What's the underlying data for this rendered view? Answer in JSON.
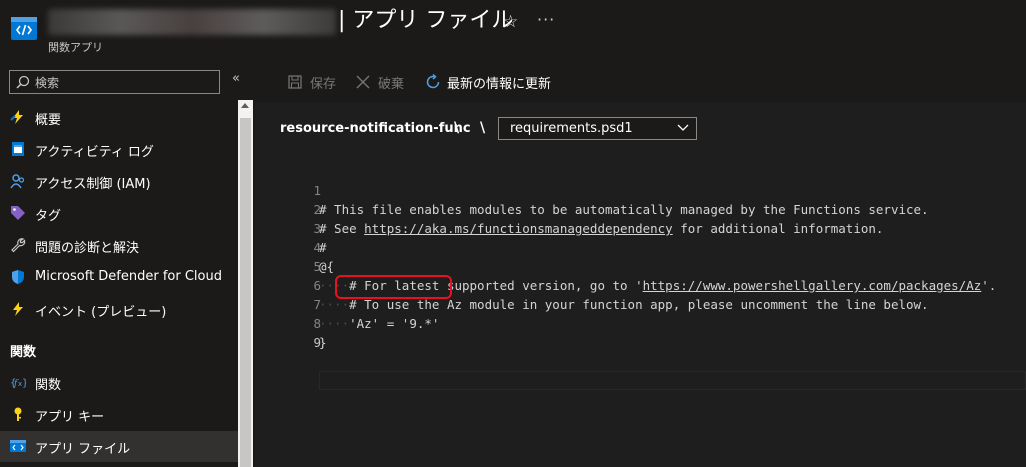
{
  "header": {
    "title": "| アプリ ファイル",
    "subtitle": "関数アプリ"
  },
  "sidebar": {
    "search_placeholder": "検索",
    "collapse_label": "«",
    "items": [
      {
        "label": "概要",
        "icon": "lightning-icon"
      },
      {
        "label": "アクティビティ ログ",
        "icon": "activity-log-icon"
      },
      {
        "label": "アクセス制御 (IAM)",
        "icon": "people-icon"
      },
      {
        "label": "タグ",
        "icon": "tag-icon"
      },
      {
        "label": "問題の診断と解決",
        "icon": "wrench-icon"
      },
      {
        "label": "Microsoft Defender for Cloud",
        "icon": "shield-icon"
      },
      {
        "label": "イベント (プレビュー)",
        "icon": "lightning-icon"
      }
    ],
    "section_functions": "関数",
    "function_items": [
      {
        "label": "関数",
        "icon": "function-icon"
      },
      {
        "label": "アプリ キー",
        "icon": "key-icon"
      },
      {
        "label": "アプリ ファイル",
        "icon": "code-icon",
        "active": true
      }
    ]
  },
  "toolbar": {
    "save_label": "保存",
    "discard_label": "破棄",
    "refresh_label": "最新の情報に更新"
  },
  "path": {
    "function_name": "resource-notification-func",
    "separator": "\\",
    "selected_file": "requirements.psd1"
  },
  "editor": {
    "lines": [
      {
        "n": "1",
        "text": "# This file enables modules to be automatically managed by the Functions service."
      },
      {
        "n": "2",
        "pre": "# See ",
        "link": "https://aka.ms/functionsmanageddependency",
        "post": " for additional information."
      },
      {
        "n": "3",
        "text": "#"
      },
      {
        "n": "4",
        "text": "@{"
      },
      {
        "n": "5",
        "pre": "# For latest supported version, go to '",
        "link": "https://www.powershellgallery.com/packages/Az",
        "post": "'."
      },
      {
        "n": "6",
        "text": "# To use the Az module in your function app, please uncomment the line below."
      },
      {
        "n": "7",
        "text": "'Az' = '9.*'"
      },
      {
        "n": "8",
        "text": "}"
      },
      {
        "n": "9",
        "text": ""
      }
    ]
  },
  "colors": {
    "accent": "#0078d4",
    "highlight_border": "#e81123"
  }
}
